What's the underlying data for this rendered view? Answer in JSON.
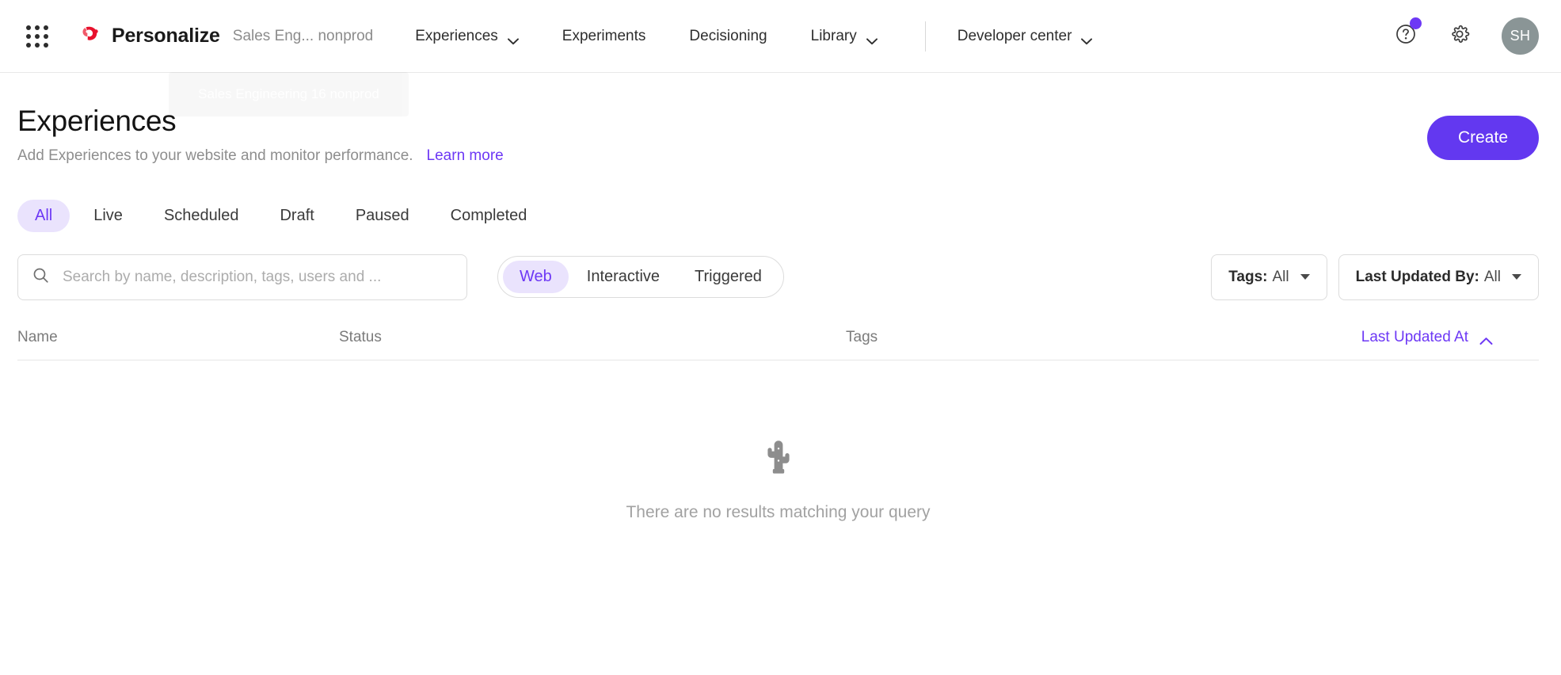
{
  "topbar": {
    "app_grid_icon": "apps-grid-icon",
    "brand": {
      "logo_icon": "personalize-logo-icon",
      "name": "Personalize"
    },
    "tenant": "Sales Eng... nonprod",
    "nav": [
      {
        "label": "Experiences",
        "has_caret": true
      },
      {
        "label": "Experiments",
        "has_caret": false
      },
      {
        "label": "Decisioning",
        "has_caret": false
      },
      {
        "label": "Library",
        "has_caret": true
      }
    ],
    "nav_secondary": [
      {
        "label": "Developer center",
        "has_caret": true
      }
    ],
    "help_icon": "help-circle-icon",
    "settings_icon": "gear-icon",
    "notification_dot_color": "#6d38f5",
    "avatar_initials": "SH",
    "avatar_color": "#8a9596"
  },
  "tooltip": {
    "text": "Sales Engineering 16 nonprod"
  },
  "page": {
    "title": "Experiences",
    "subtitle": "Add Experiences to your website and monitor performance.",
    "learn_more": "Learn more",
    "create_button": "Create"
  },
  "status_tabs": {
    "active": "All",
    "items": [
      {
        "label": "All"
      },
      {
        "label": "Live"
      },
      {
        "label": "Scheduled"
      },
      {
        "label": "Draft"
      },
      {
        "label": "Paused"
      },
      {
        "label": "Completed"
      }
    ]
  },
  "filters": {
    "search": {
      "icon": "search-icon",
      "value": "",
      "placeholder": "Search by name, description, tags, users and ..."
    },
    "segmented": {
      "active": "Web",
      "items": [
        {
          "label": "Web"
        },
        {
          "label": "Interactive"
        },
        {
          "label": "Triggered"
        }
      ]
    },
    "tags_dropdown": {
      "label": "Tags:",
      "value": "All"
    },
    "updated_by_dropdown": {
      "label": "Last Updated By:",
      "value": "All"
    }
  },
  "table": {
    "columns": [
      {
        "label": "Name"
      },
      {
        "label": "Status"
      },
      {
        "label": "Tags"
      },
      {
        "label": "Last Updated At"
      }
    ],
    "sort_column": "Last Updated At",
    "sort_direction": "asc",
    "sort_icon": "chevron-up-icon",
    "rows": []
  },
  "empty_state": {
    "icon": "cactus-icon",
    "message": "There are no results matching your query"
  },
  "colors": {
    "accent_purple": "#6d38f5",
    "accent_purple_soft": "#eae3fd",
    "create_purple": "#6338f0",
    "brand_red": "#e8112d",
    "muted_text": "#8e8e8e"
  }
}
